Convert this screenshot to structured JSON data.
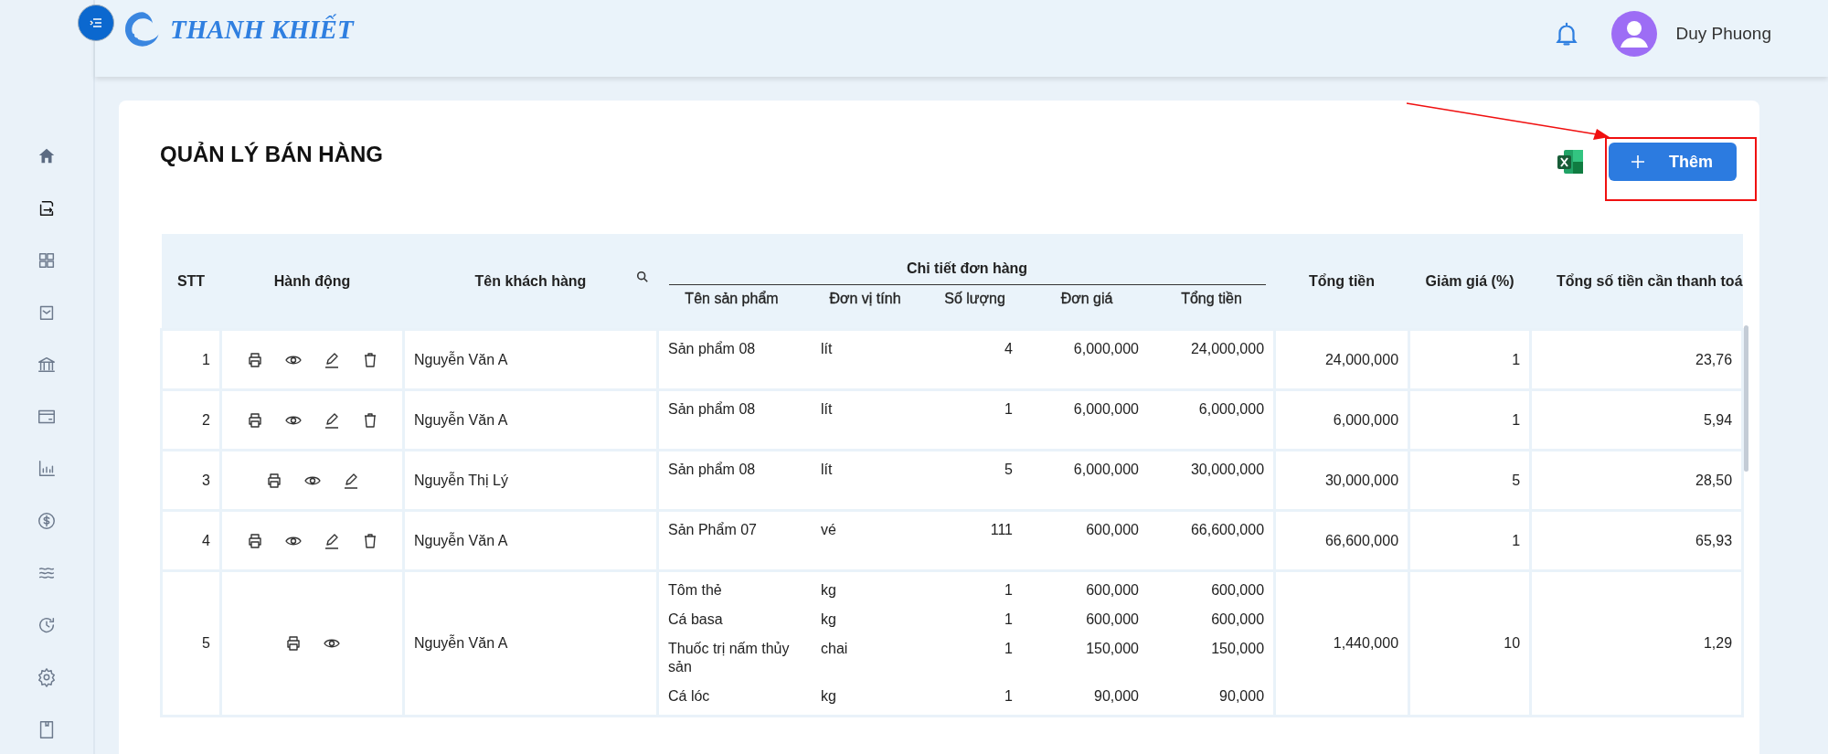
{
  "app": {
    "logo_text": "THANH KHIẾT"
  },
  "sidebar": {
    "items": [
      {
        "kind": "home",
        "selected": false
      },
      {
        "kind": "transfer",
        "selected": true
      },
      {
        "kind": "grid",
        "selected": false
      },
      {
        "kind": "bag",
        "selected": false
      },
      {
        "kind": "bank",
        "selected": false
      },
      {
        "kind": "card",
        "selected": false
      },
      {
        "kind": "chart",
        "selected": false
      },
      {
        "kind": "dollar",
        "selected": false
      },
      {
        "kind": "waves",
        "selected": false
      },
      {
        "kind": "history",
        "selected": false
      },
      {
        "kind": "settings",
        "selected": false
      },
      {
        "kind": "book",
        "selected": false
      }
    ]
  },
  "user": {
    "name": "Duy Phuong"
  },
  "page": {
    "title": "QUẢN LÝ BÁN HÀNG",
    "add_button": "Thêm"
  },
  "table": {
    "columns": {
      "stt": "STT",
      "actions": "Hành động",
      "customer": "Tên khách hàng",
      "details": "Chi tiết đơn hàng",
      "product": "Tên sản phẩm",
      "unit": "Đơn vị tính",
      "qty": "Số lượng",
      "price": "Đơn giá",
      "line_total": "Tổng tiền",
      "total": "Tổng tiền",
      "discount": "Giảm giá (%)",
      "payable": "Tổng số tiền cần thanh toá"
    },
    "rows": [
      {
        "stt": "1",
        "actions": [
          {
            "kind": "print"
          },
          {
            "kind": "view"
          },
          {
            "kind": "edit"
          },
          {
            "kind": "delete"
          }
        ],
        "customer": "Nguyễn Văn A",
        "items": [
          {
            "product": "Sản phẩm 08",
            "unit": "lít",
            "qty": "4",
            "price": "6,000,000",
            "total": "24,000,000"
          }
        ],
        "total": "24,000,000",
        "discount": "1",
        "payable": "23,76"
      },
      {
        "stt": "2",
        "actions": [
          {
            "kind": "print"
          },
          {
            "kind": "view"
          },
          {
            "kind": "edit"
          },
          {
            "kind": "delete"
          }
        ],
        "customer": "Nguyễn Văn A",
        "items": [
          {
            "product": "Sản phẩm 08",
            "unit": "lít",
            "qty": "1",
            "price": "6,000,000",
            "total": "6,000,000"
          }
        ],
        "total": "6,000,000",
        "discount": "1",
        "payable": "5,94"
      },
      {
        "stt": "3",
        "actions": [
          {
            "kind": "print"
          },
          {
            "kind": "view"
          },
          {
            "kind": "edit"
          }
        ],
        "customer": "Nguyễn Thị Lý",
        "items": [
          {
            "product": "Sản phẩm 08",
            "unit": "lít",
            "qty": "5",
            "price": "6,000,000",
            "total": "30,000,000"
          }
        ],
        "total": "30,000,000",
        "discount": "5",
        "payable": "28,50"
      },
      {
        "stt": "4",
        "actions": [
          {
            "kind": "print"
          },
          {
            "kind": "view"
          },
          {
            "kind": "edit"
          },
          {
            "kind": "delete"
          }
        ],
        "customer": "Nguyễn Văn A",
        "items": [
          {
            "product": "Sản Phẩm 07",
            "unit": "vé",
            "qty": "111",
            "price": "600,000",
            "total": "66,600,000"
          }
        ],
        "total": "66,600,000",
        "discount": "1",
        "payable": "65,93"
      },
      {
        "stt": "5",
        "actions": [
          {
            "kind": "print"
          },
          {
            "kind": "view"
          }
        ],
        "customer": "Nguyễn Văn A",
        "items": [
          {
            "product": "Tôm thẻ",
            "unit": "kg",
            "qty": "1",
            "price": "600,000",
            "total": "600,000"
          },
          {
            "product": "Cá basa",
            "unit": "kg",
            "qty": "1",
            "price": "600,000",
            "total": "600,000"
          },
          {
            "product": "Thuốc trị nấm thủy sản",
            "unit": "chai",
            "qty": "1",
            "price": "150,000",
            "total": "150,000"
          },
          {
            "product": "Cá lóc",
            "unit": "kg",
            "qty": "1",
            "price": "90,000",
            "total": "90,000"
          }
        ],
        "total": "1,440,000",
        "discount": "10",
        "payable": "1,29"
      }
    ]
  }
}
